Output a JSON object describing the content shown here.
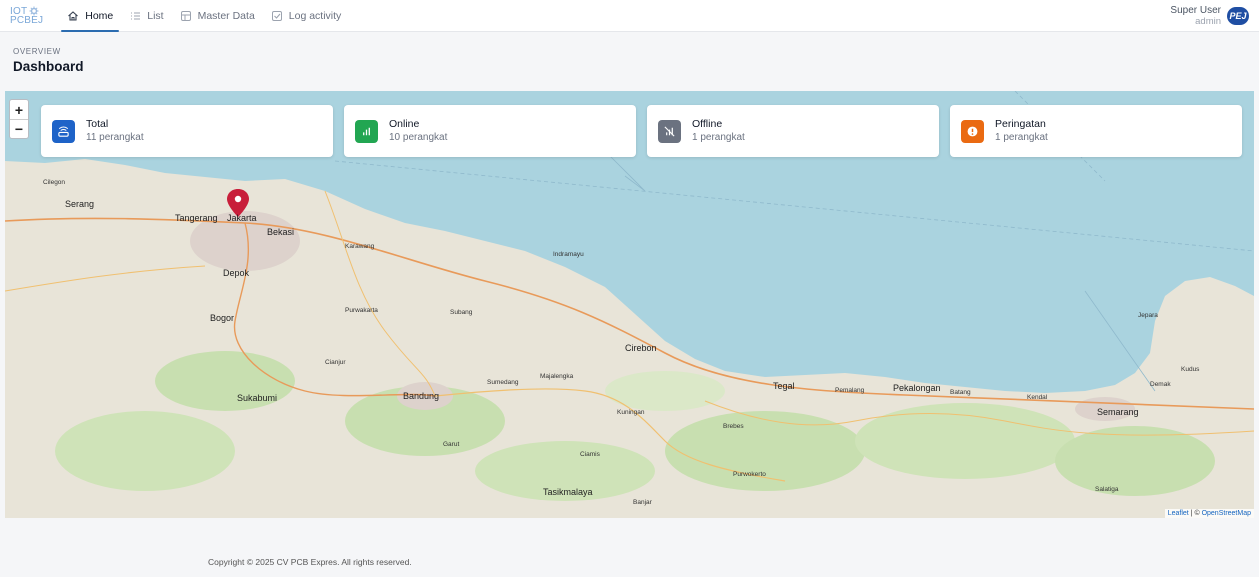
{
  "nav": {
    "logo_line1": "IOT",
    "logo_line2": "PCBEJ",
    "items": [
      {
        "label": "Home",
        "icon": "home-icon",
        "active": true
      },
      {
        "label": "List",
        "icon": "list-icon",
        "active": false
      },
      {
        "label": "Master Data",
        "icon": "database-icon",
        "active": false
      },
      {
        "label": "Log activity",
        "icon": "checkbox-icon",
        "active": false
      }
    ],
    "user_name": "Super User",
    "user_role": "admin",
    "avatar_text": "PEJ"
  },
  "header": {
    "overline": "OVERVIEW",
    "title": "Dashboard"
  },
  "cards": [
    {
      "label": "Total",
      "value": "11 perangkat",
      "color": "#1e63c8",
      "icon": "router-icon"
    },
    {
      "label": "Online",
      "value": "10 perangkat",
      "color": "#22a652",
      "icon": "signal-icon"
    },
    {
      "label": "Offline",
      "value": "1 perangkat",
      "color": "#6b7280",
      "icon": "no-signal-icon"
    },
    {
      "label": "Peringatan",
      "value": "1 perangkat",
      "color": "#ea6a12",
      "icon": "alert-icon"
    }
  ],
  "map": {
    "zoom_in": "+",
    "zoom_out": "−",
    "attribution_leaflet": "Leaflet",
    "attribution_sep": " | © ",
    "attribution_osm": "OpenStreetMap",
    "marker_color": "#c81e3a",
    "labels": [
      "Jakarta",
      "Tangerang",
      "Bekasi",
      "Bogor",
      "Depok",
      "Serang",
      "Cilegon",
      "Karawang",
      "Subang",
      "Purwakarta",
      "Bandung",
      "Sumedang",
      "Cirebon",
      "Indramayu",
      "Sukabumi",
      "Cianjur",
      "Garut",
      "Tasikmalaya",
      "Kuningan",
      "Majalengka",
      "Tegal",
      "Pekalongan",
      "Semarang",
      "Kendal",
      "Brebes",
      "Pemalang",
      "Batang",
      "Jepara",
      "Kudus",
      "Demak",
      "Salatiga",
      "Purwokerto",
      "Banjar",
      "Ciamis"
    ]
  },
  "footer": {
    "copyright": "Copyright © 2025 CV PCB Expres. All rights reserved."
  }
}
